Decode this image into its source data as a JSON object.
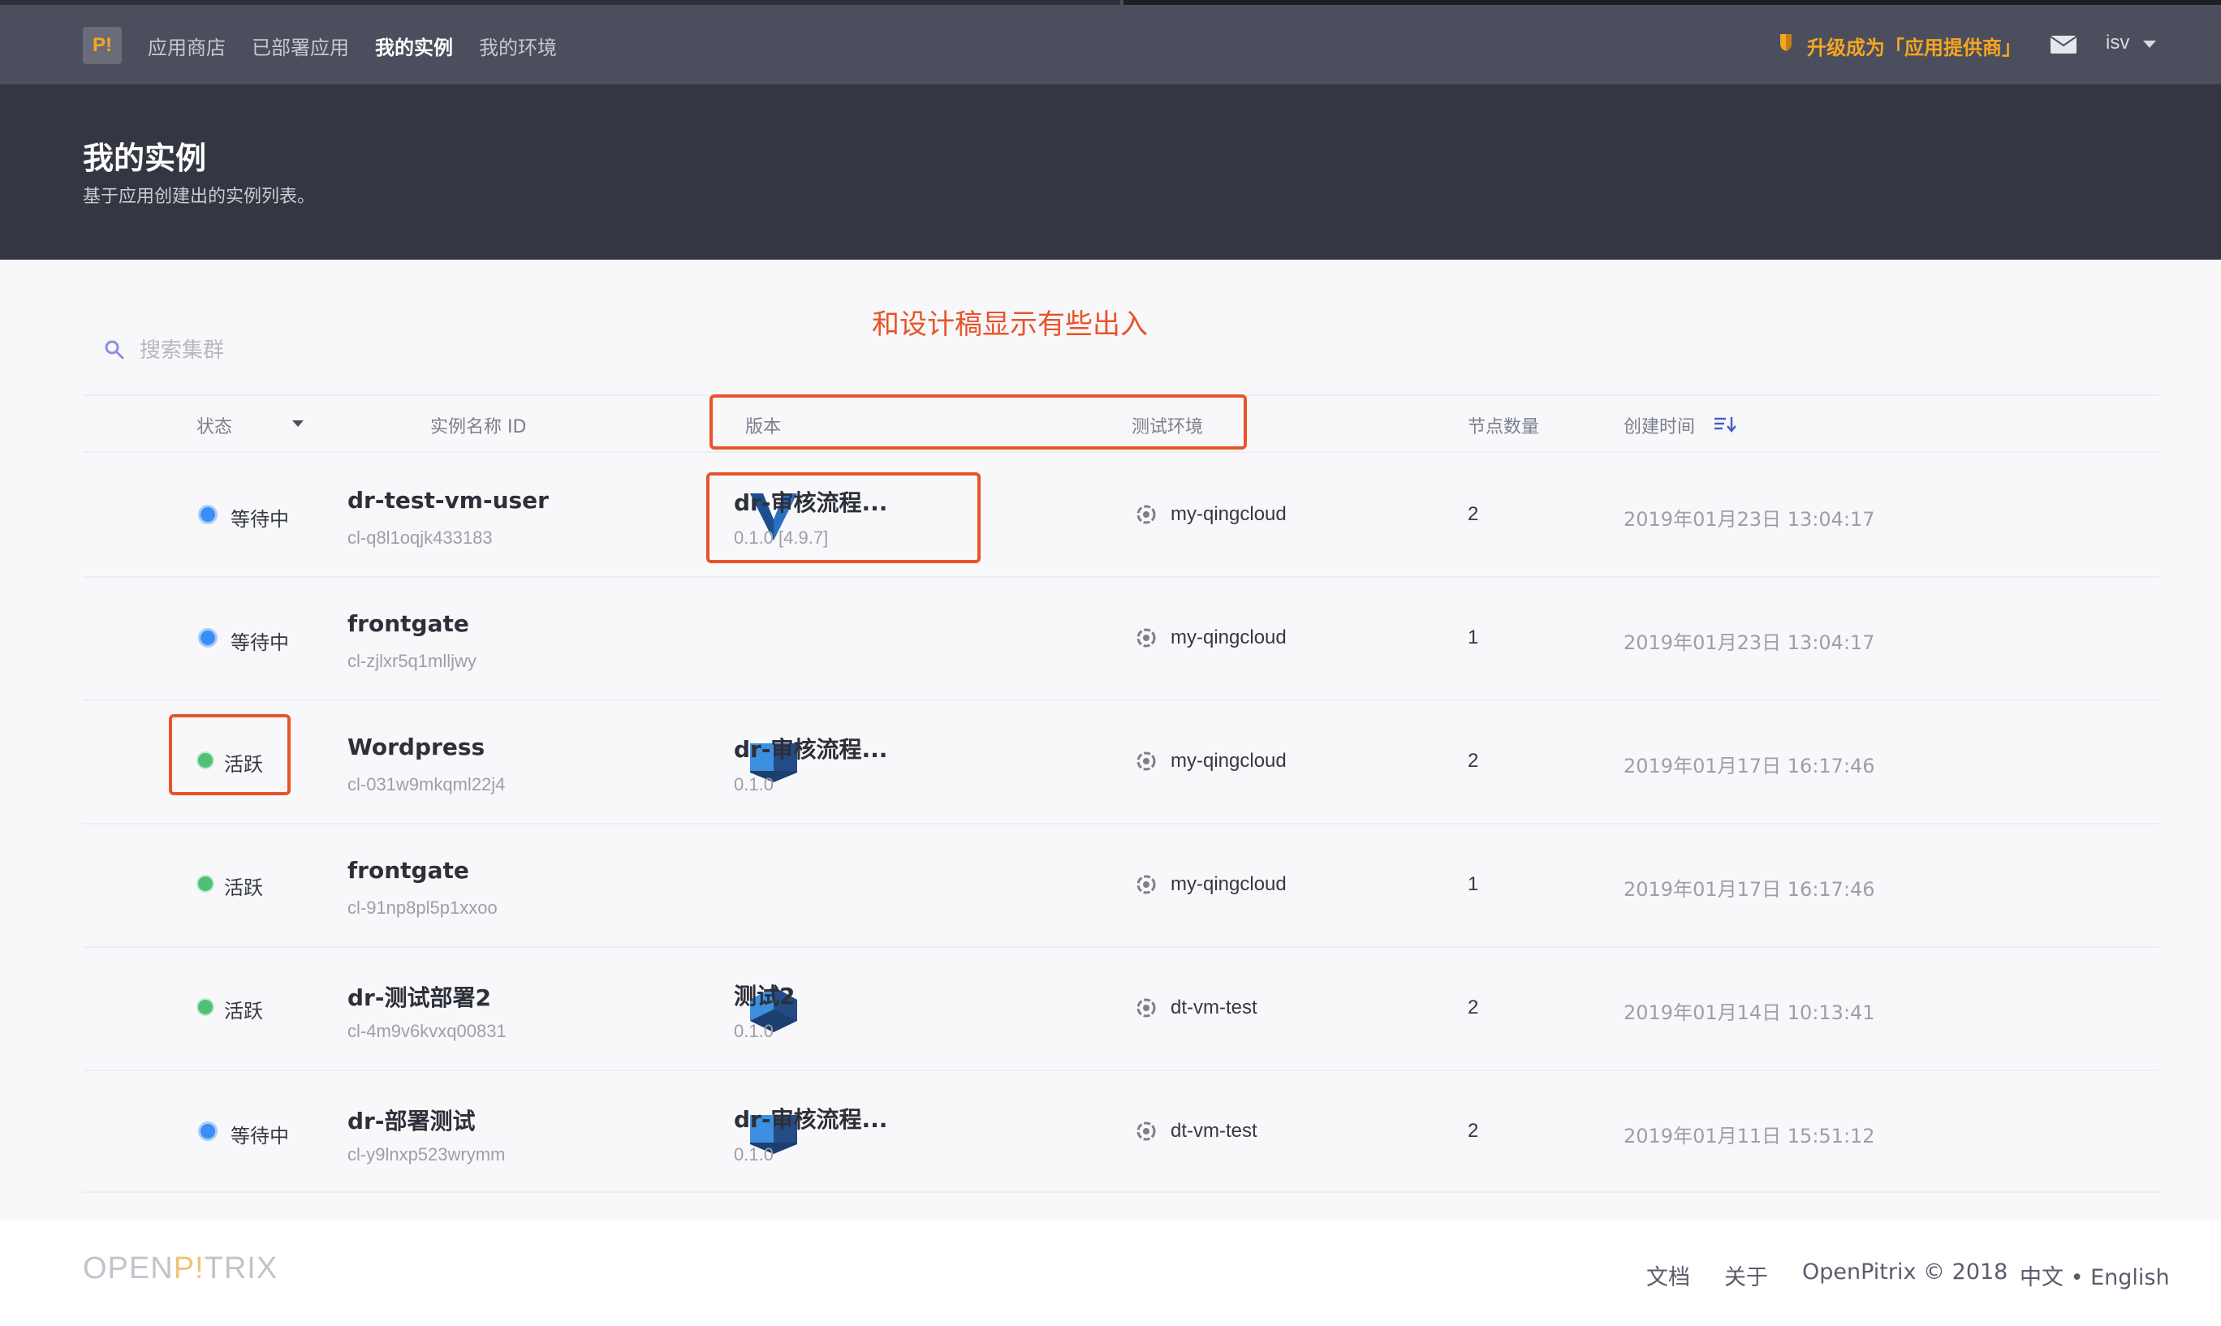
{
  "header": {
    "logo": "P!",
    "nav": [
      "应用商店",
      "已部署应用",
      "我的实例",
      "我的环境"
    ],
    "upgrade": "升级成为「应用提供商」",
    "user": "isv"
  },
  "banner": {
    "title": "我的实例",
    "subtitle": "基于应用创建出的实例列表。"
  },
  "annotation": "和设计稿显示有些出入",
  "search": {
    "placeholder": "搜索集群"
  },
  "table": {
    "headers": {
      "status": "状态",
      "name": "实例名称 ID",
      "version": "版本",
      "env": "测试环境",
      "nodes": "节点数量",
      "created": "创建时间"
    },
    "rows": [
      {
        "status": "等待中",
        "name": "dr-test-vm-user",
        "id": "cl-q8l1oqjk433183",
        "app": "dr-审核流程...",
        "version": "0.1.0 [4.9.7]",
        "env": "my-qingcloud",
        "nodes": "2",
        "created": "2019年01月23日 13:04:17"
      },
      {
        "status": "等待中",
        "name": "frontgate",
        "id": "cl-zjlxr5q1mlljwy",
        "app": "",
        "version": "",
        "env": "my-qingcloud",
        "nodes": "1",
        "created": "2019年01月23日 13:04:17"
      },
      {
        "status": "活跃",
        "name": "Wordpress",
        "id": "cl-031w9mkqml22j4",
        "app": "dr-审核流程...",
        "version": "0.1.0",
        "env": "my-qingcloud",
        "nodes": "2",
        "created": "2019年01月17日 16:17:46"
      },
      {
        "status": "活跃",
        "name": "frontgate",
        "id": "cl-91np8pl5p1xxoo",
        "app": "",
        "version": "",
        "env": "my-qingcloud",
        "nodes": "1",
        "created": "2019年01月17日 16:17:46"
      },
      {
        "status": "活跃",
        "name": "dr-测试部署2",
        "id": "cl-4m9v6kvxq00831",
        "app": "测试2",
        "version": "0.1.0",
        "env": "dt-vm-test",
        "nodes": "2",
        "created": "2019年01月14日 10:13:41"
      },
      {
        "status": "等待中",
        "name": "dr-部署测试",
        "id": "cl-y9lnxp523wrymm",
        "app": "dr-审核流程...",
        "version": "0.1.0",
        "env": "dt-vm-test",
        "nodes": "2",
        "created": "2019年01月11日 15:51:12"
      }
    ]
  },
  "footer": {
    "logo_open": "OPEN",
    "logo_mid": "P!",
    "logo_end": "TRIX",
    "docs": "文档",
    "about": "关于",
    "copyright": "OpenPitrix © 2018",
    "lang": "中文 • English"
  },
  "colors": {
    "annotation": "#e8542a",
    "pending": "#3b8ef5",
    "active": "#4ec175",
    "upgrade": "#f5a623"
  },
  "icons": [
    "search-icon",
    "shield-icon",
    "mail-icon",
    "chevron-down-icon",
    "sort-icon",
    "cloud-env-icon",
    "app-icon"
  ]
}
